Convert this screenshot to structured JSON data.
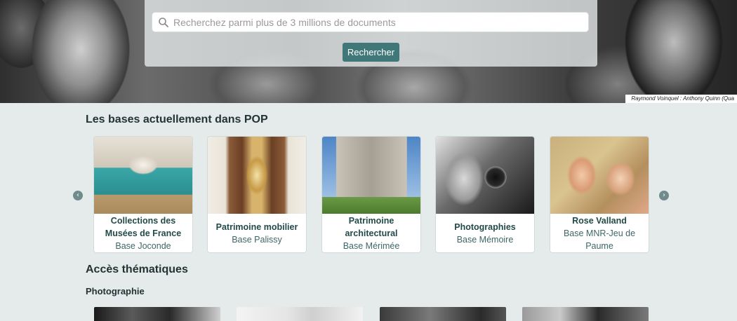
{
  "hero": {
    "search_placeholder": "Recherchez parmi plus de 3 millions de documents",
    "search_button": "Rechercher",
    "photo_credit": "Raymond Voinquel : Anthony Quinn (Qua"
  },
  "bases": {
    "title": "Les bases actuellement dans POP",
    "prev_arrow": "‹",
    "next_arrow": "›",
    "cards": [
      {
        "name": "Collections des Musées de France",
        "base": "Base Joconde"
      },
      {
        "name": "Patrimoine mobilier",
        "base": "Base Palissy"
      },
      {
        "name": "Patrimoine architectural",
        "base": "Base Mérimée"
      },
      {
        "name": "Photographies",
        "base": "Base Mémoire"
      },
      {
        "name": "Rose Valland",
        "base": "Base MNR-Jeu de Paume"
      }
    ]
  },
  "thematic": {
    "title": "Accès thématiques",
    "subtitle": "Photographie"
  },
  "colors": {
    "accent": "#40787a",
    "background": "#e5ebeb"
  }
}
